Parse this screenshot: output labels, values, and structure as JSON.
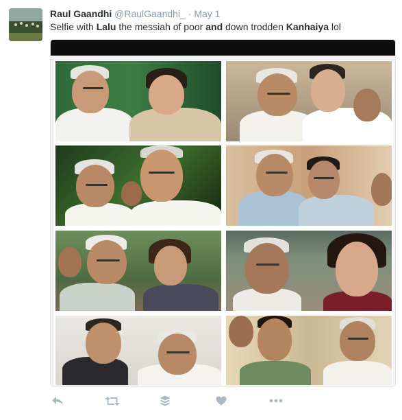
{
  "tweet": {
    "author_name": "Raul Gaandhi",
    "handle": "@RaulGaandhi_",
    "separator": "·",
    "date": "May 1",
    "text_parts": [
      {
        "text": "Selfie with ",
        "bold": false
      },
      {
        "text": "Lalu",
        "bold": true
      },
      {
        "text": " the messiah of poor ",
        "bold": false
      },
      {
        "text": "and",
        "bold": true
      },
      {
        "text": " down trodden ",
        "bold": false
      },
      {
        "text": "Kanhaiya",
        "bold": true
      },
      {
        "text": " lol",
        "bold": false
      }
    ]
  },
  "media": {
    "photos": [
      {
        "name": "photo-lalu-sonia"
      },
      {
        "name": "photo-lalu-rahul"
      },
      {
        "name": "photo-lalu-nitish"
      },
      {
        "name": "photo-lalu-kejriwal"
      },
      {
        "name": "photo-lalu-barkha"
      },
      {
        "name": "photo-lalu-selfie-woman"
      },
      {
        "name": "photo-lalu-rajdeep"
      },
      {
        "name": "photo-lalu-kanhaiya"
      }
    ]
  },
  "actions": [
    {
      "name": "reply-icon"
    },
    {
      "name": "retweet-icon"
    },
    {
      "name": "buffer-icon"
    },
    {
      "name": "like-icon"
    },
    {
      "name": "more-icon"
    }
  ],
  "colors": {
    "text": "#292f33",
    "secondary": "#8899a6",
    "action_icon": "#aab8c2",
    "border": "#e1e8ed"
  }
}
